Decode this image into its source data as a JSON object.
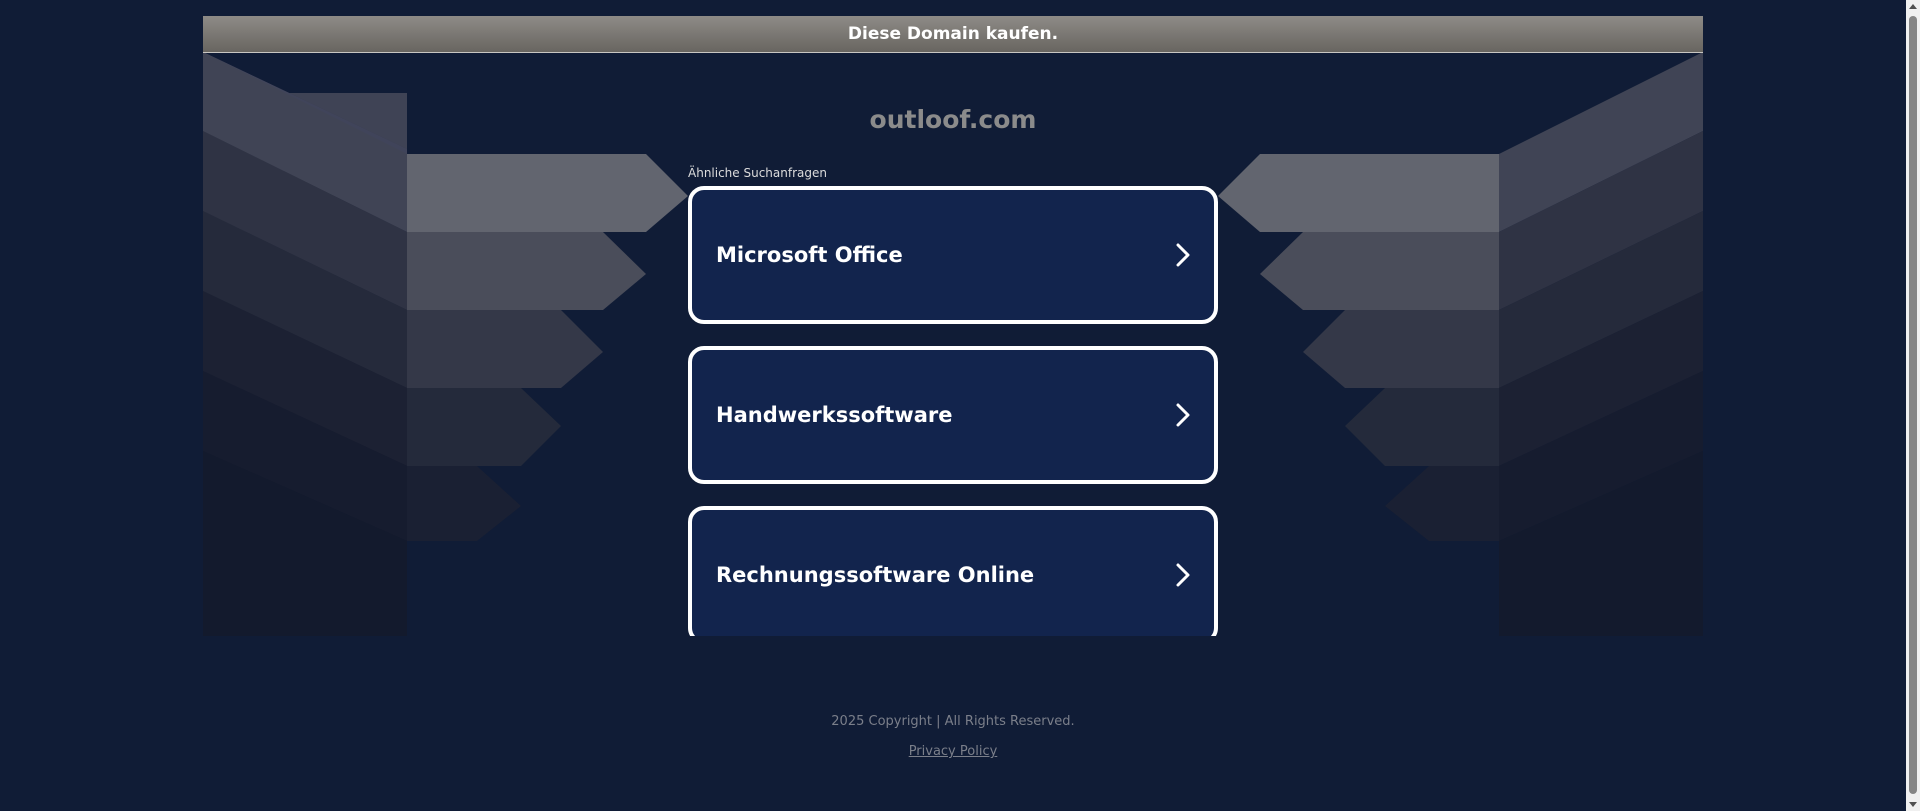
{
  "buy_banner": {
    "label": "Diese Domain kaufen."
  },
  "domain": {
    "name": "outloof.com"
  },
  "related": {
    "heading": "Ähnliche Suchanfragen",
    "links": [
      {
        "label": "Microsoft Office"
      },
      {
        "label": "Handwerkssoftware"
      },
      {
        "label": "Rechnungssoftware Online"
      }
    ]
  },
  "footer": {
    "copyright": "2025 Copyright | All Rights Reserved.",
    "privacy": "Privacy Policy"
  },
  "colors": {
    "page_bg": "#101c36",
    "link_bg": "#12244d",
    "banner_bg": "#7a7773",
    "muted_text": "#8b8b8b"
  },
  "icons": {
    "link_arrow": "chevron-right-icon"
  }
}
